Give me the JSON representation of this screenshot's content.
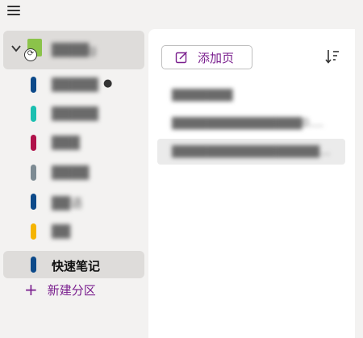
{
  "nav": {
    "menu_icon": "hamburger-icon",
    "notebook": {
      "name": "████g",
      "icon": "notebook-sync-icon",
      "expanded": true
    },
    "sections": [
      {
        "label": "█████",
        "color": "#0d4a8a",
        "marker": "●",
        "active": false
      },
      {
        "label": "█████",
        "color": "#1bbfb0",
        "marker": "",
        "active": false
      },
      {
        "label": "███",
        "color": "#b0124a",
        "marker": "",
        "active": false
      },
      {
        "label": "████",
        "color": "#7d8b93",
        "marker": "",
        "active": false
      },
      {
        "label": "██语",
        "color": "#0d4a8a",
        "marker": "",
        "active": false
      },
      {
        "label": "██",
        "color": "#f5b400",
        "marker": "",
        "active": false
      },
      {
        "label": "快速笔记",
        "color": "#0d4a8a",
        "marker": "",
        "active": true
      }
    ],
    "new_section_label": "新建分区"
  },
  "pages": {
    "add_page_label": "添加页",
    "sort_icon": "sort-icon",
    "items": [
      {
        "title": "███████",
        "active": false
      },
      {
        "title": "███████████████0....",
        "active": false
      },
      {
        "title": "█████████████████...",
        "active": true
      }
    ]
  },
  "colors": {
    "accent": "#7a1f8e",
    "nav_bg": "#f3f2f1",
    "selected_bg": "#dedcda"
  }
}
